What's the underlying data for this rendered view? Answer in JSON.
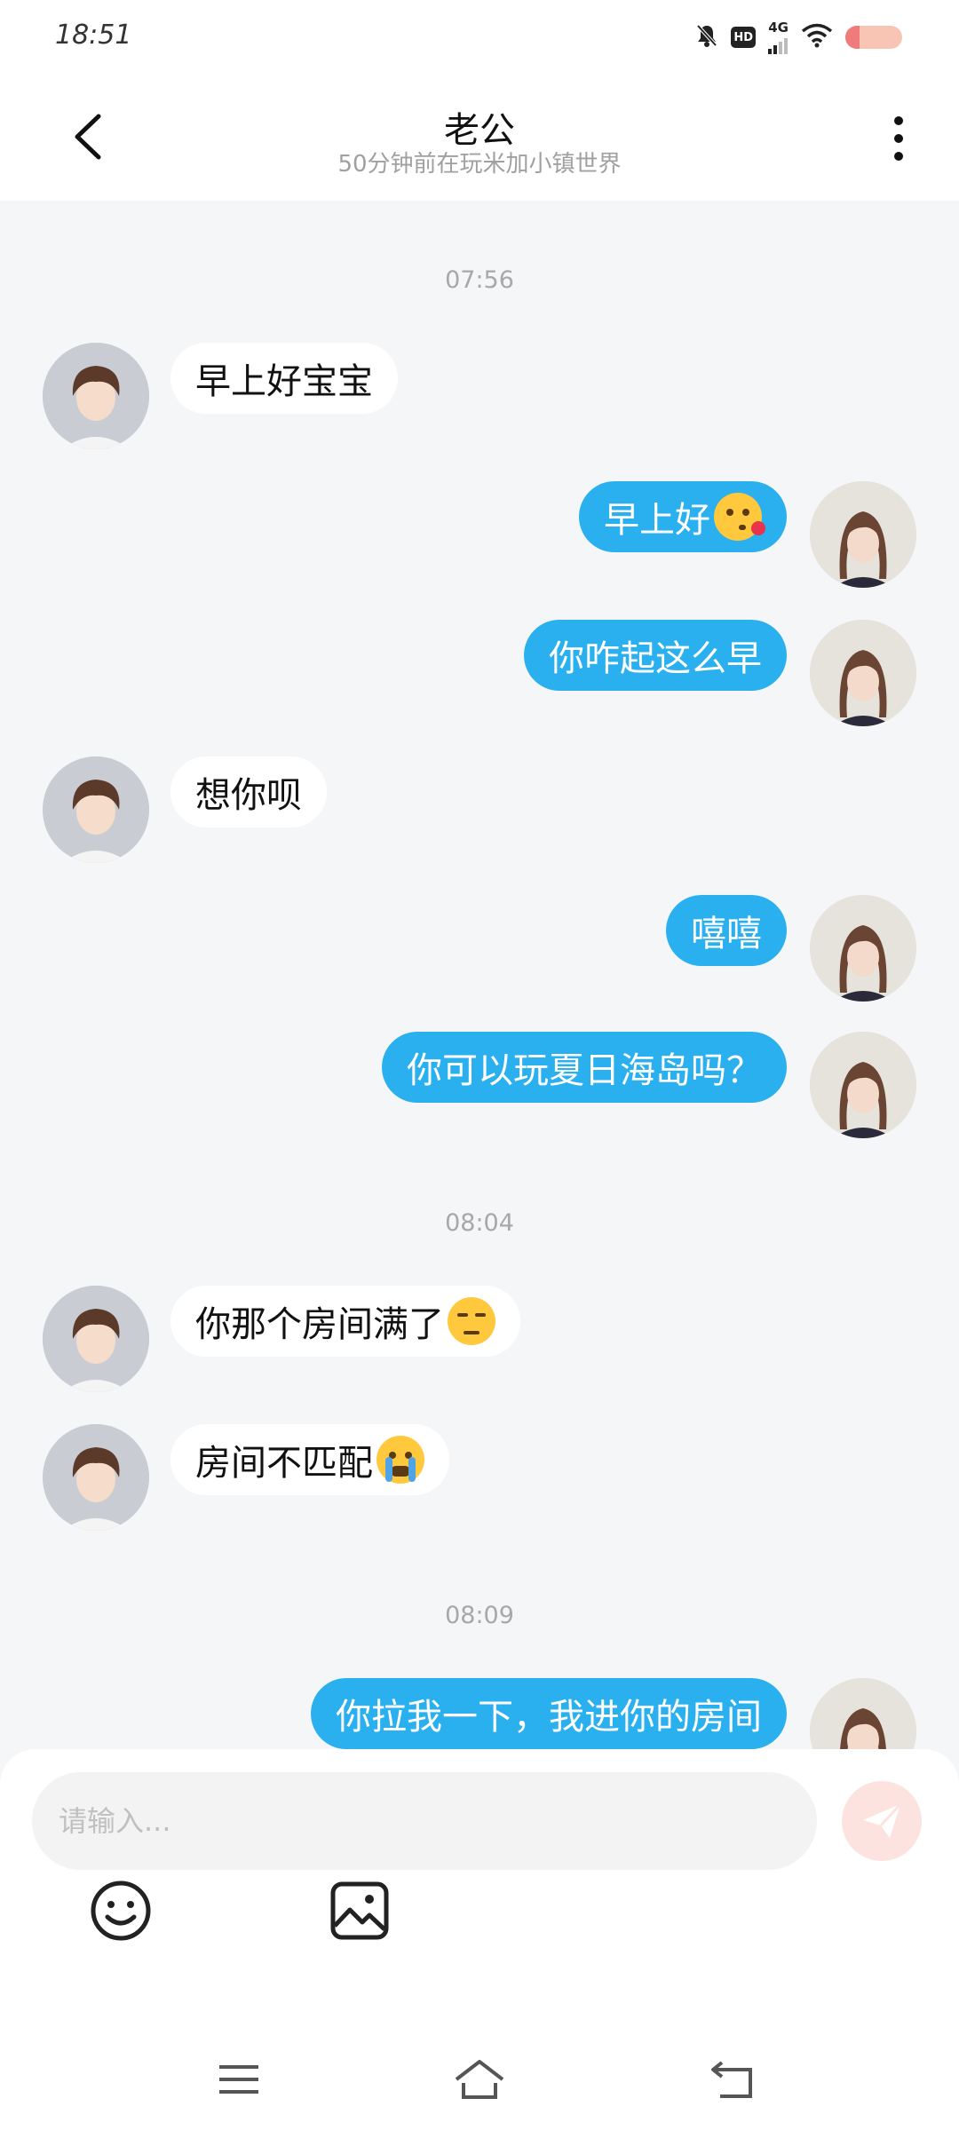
{
  "status_bar": {
    "time": "18:51",
    "hd_label": "HD",
    "network_label": "4G",
    "battery_level_percent": 25
  },
  "header": {
    "title": "老公",
    "subtitle": "50分钟前在玩米加小镇世界"
  },
  "messages": {
    "time_1": "07:56",
    "m1": "早上好宝宝",
    "m2": "早上好",
    "m3": "你咋起这么早",
    "m4": "想你呗",
    "m5": "嘻嘻",
    "m6": "你可以玩夏日海岛吗？",
    "time_2": "08:04",
    "m7": "你那个房间满了",
    "m8": "房间不匹配",
    "time_3": "08:09",
    "m9": "你拉我一下，我进你的房间"
  },
  "input": {
    "placeholder": "请输入..."
  },
  "icons": {
    "back": "chevron-left-icon",
    "more": "more-vertical-icon",
    "send": "paper-plane-icon",
    "emoji": "smiley-icon",
    "image": "image-icon",
    "nav_menu": "menu-icon",
    "nav_home": "home-icon",
    "nav_back": "back-icon"
  },
  "colors": {
    "outgoing_bubble": "#2bb0ef",
    "incoming_bubble": "#ffffff",
    "chat_background": "#f4f6f8",
    "send_button": "#fde3df"
  }
}
